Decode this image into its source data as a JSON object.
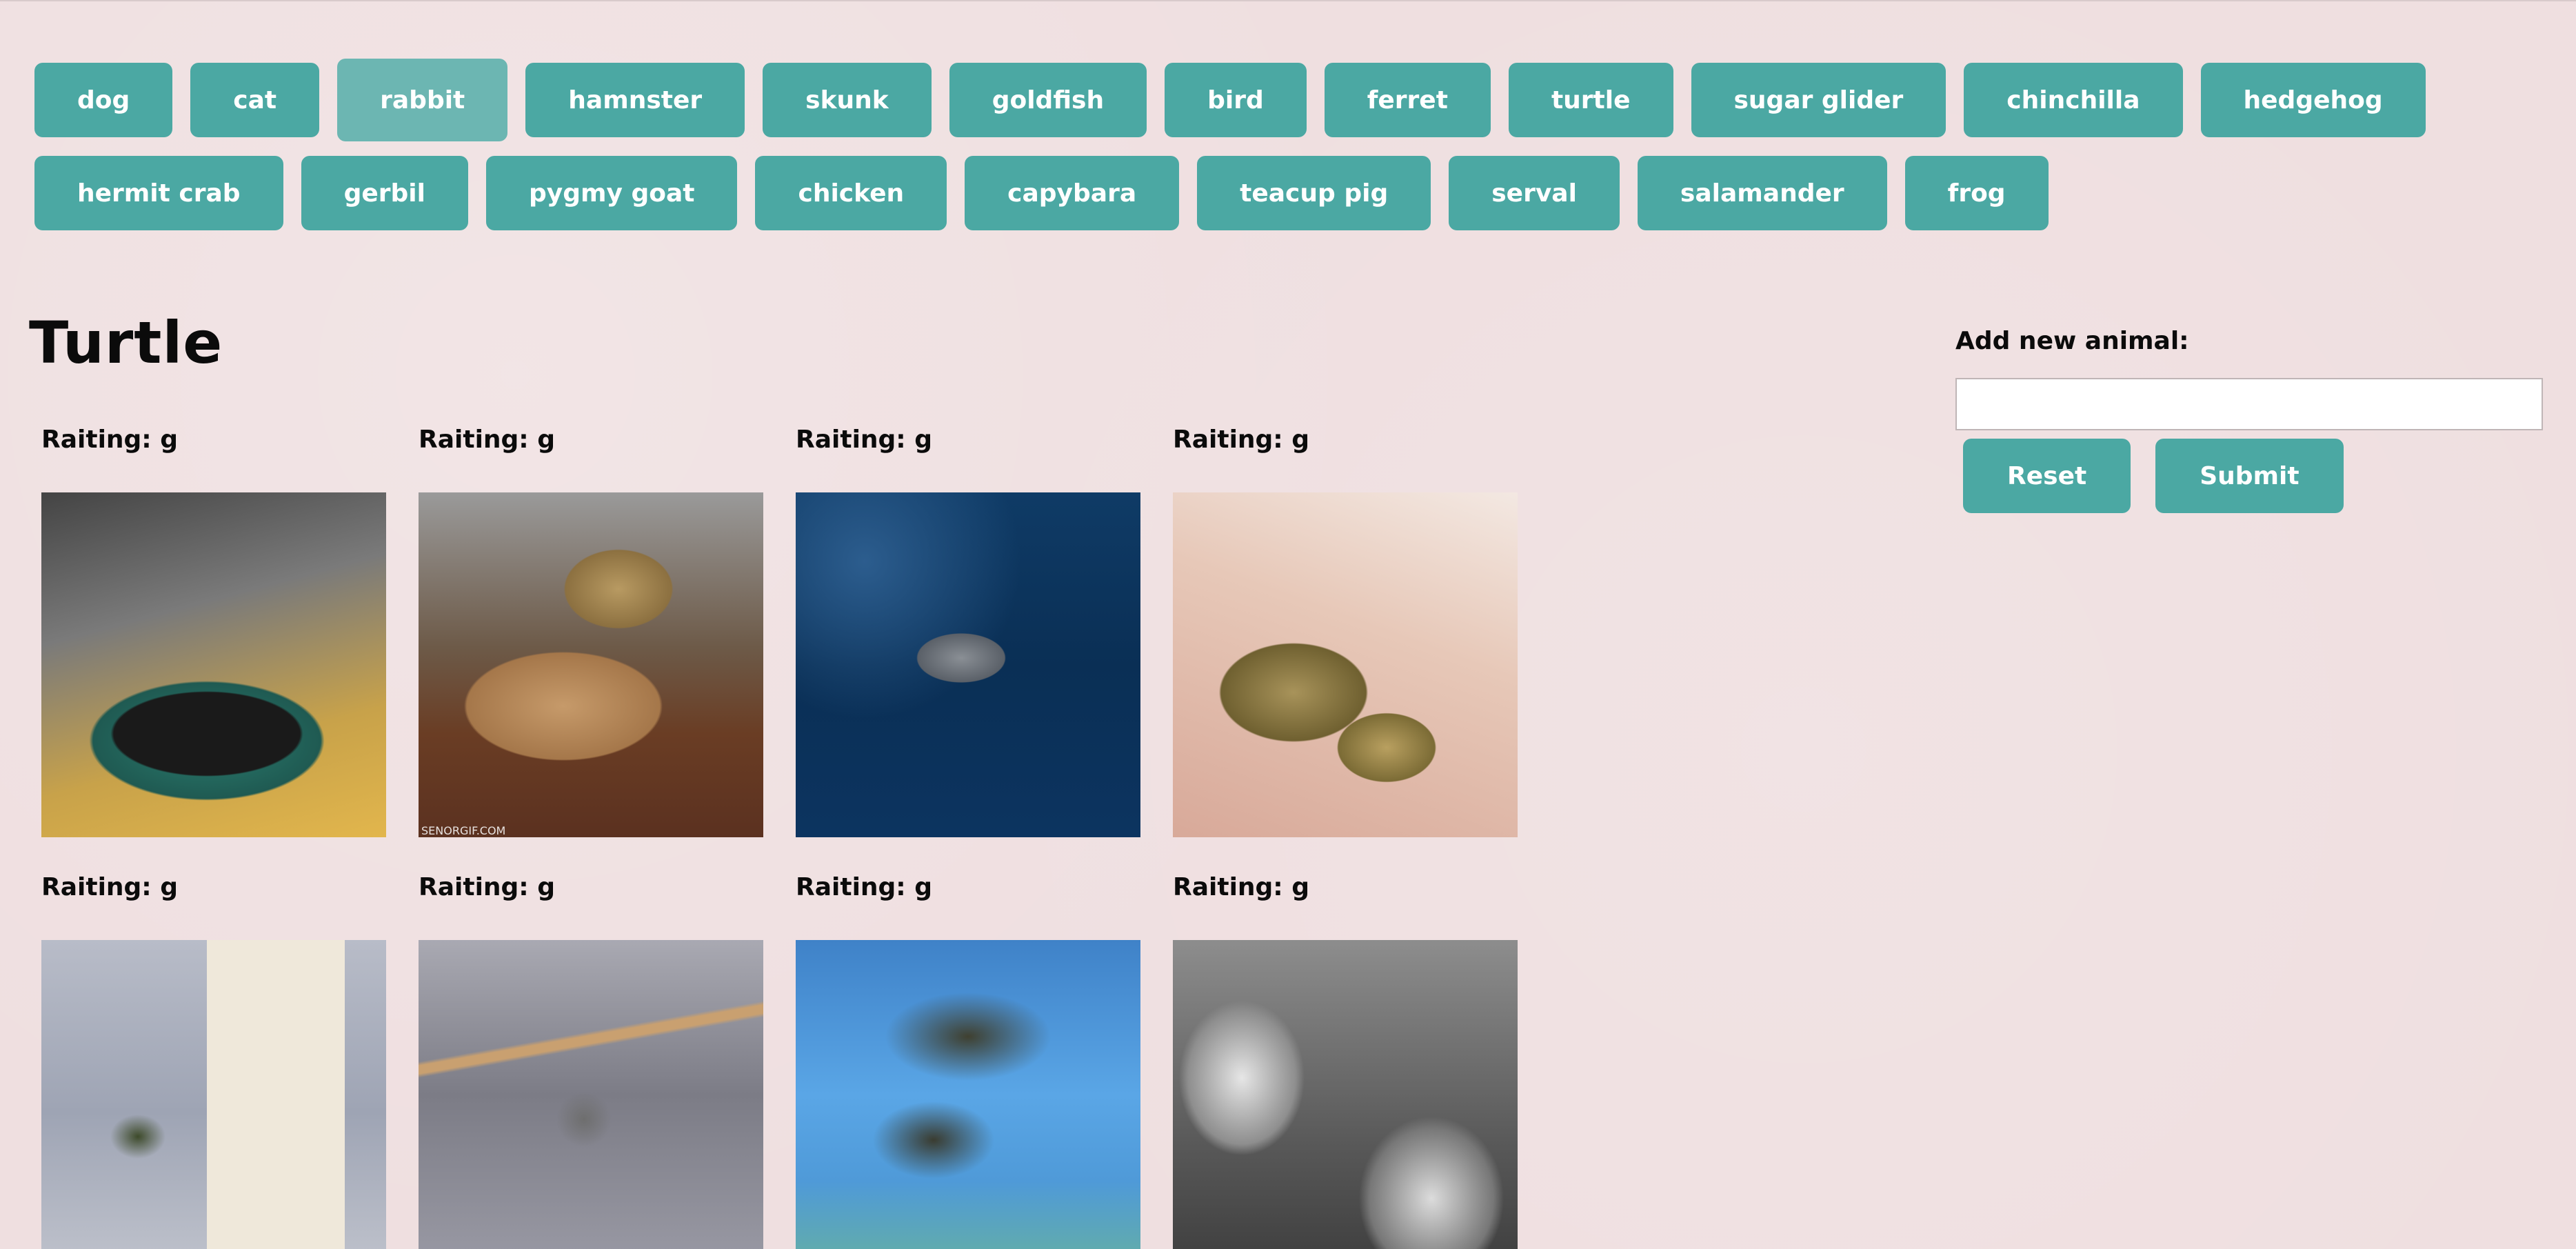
{
  "nav": {
    "row1": [
      "dog",
      "cat",
      "rabbit",
      "hamnster",
      "skunk",
      "goldfish",
      "bird",
      "ferret",
      "turtle",
      "sugar glider",
      "chinchilla",
      "hedgehog"
    ],
    "row2": [
      "hermit crab",
      "gerbil",
      "pygmy goat",
      "chicken",
      "capybara",
      "teacup pig",
      "serval",
      "salamander",
      "frog"
    ],
    "active": "rabbit"
  },
  "main": {
    "title": "Turtle",
    "gifs": [
      {
        "rating": "Raiting: g",
        "watermark": ""
      },
      {
        "rating": "Raiting: g",
        "watermark": "SENORGIF.COM"
      },
      {
        "rating": "Raiting: g",
        "watermark": ""
      },
      {
        "rating": "Raiting: g",
        "watermark": ""
      },
      {
        "rating": "Raiting: g",
        "watermark": ""
      },
      {
        "rating": "Raiting: g",
        "watermark": ""
      },
      {
        "rating": "Raiting: g",
        "watermark": ""
      },
      {
        "rating": "Raiting: g",
        "watermark": ""
      }
    ]
  },
  "form": {
    "label": "Add new animal:",
    "input_value": "",
    "reset_label": "Reset",
    "submit_label": "Submit"
  },
  "colors": {
    "background": "#efdfe0",
    "button": "#4ba8a3",
    "button_active": "#6cb6b2",
    "button_text": "#ffffff"
  }
}
